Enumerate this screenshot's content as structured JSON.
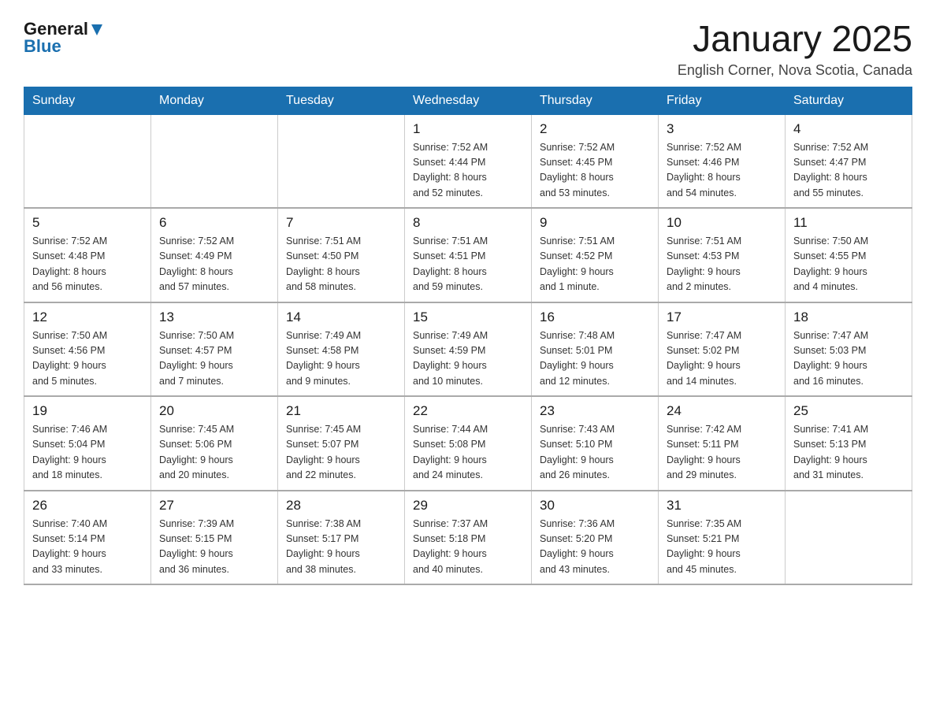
{
  "header": {
    "logo_general": "General",
    "logo_blue": "Blue",
    "title": "January 2025",
    "subtitle": "English Corner, Nova Scotia, Canada"
  },
  "days_of_week": [
    "Sunday",
    "Monday",
    "Tuesday",
    "Wednesday",
    "Thursday",
    "Friday",
    "Saturday"
  ],
  "weeks": [
    [
      {
        "day": "",
        "info": ""
      },
      {
        "day": "",
        "info": ""
      },
      {
        "day": "",
        "info": ""
      },
      {
        "day": "1",
        "info": "Sunrise: 7:52 AM\nSunset: 4:44 PM\nDaylight: 8 hours\nand 52 minutes."
      },
      {
        "day": "2",
        "info": "Sunrise: 7:52 AM\nSunset: 4:45 PM\nDaylight: 8 hours\nand 53 minutes."
      },
      {
        "day": "3",
        "info": "Sunrise: 7:52 AM\nSunset: 4:46 PM\nDaylight: 8 hours\nand 54 minutes."
      },
      {
        "day": "4",
        "info": "Sunrise: 7:52 AM\nSunset: 4:47 PM\nDaylight: 8 hours\nand 55 minutes."
      }
    ],
    [
      {
        "day": "5",
        "info": "Sunrise: 7:52 AM\nSunset: 4:48 PM\nDaylight: 8 hours\nand 56 minutes."
      },
      {
        "day": "6",
        "info": "Sunrise: 7:52 AM\nSunset: 4:49 PM\nDaylight: 8 hours\nand 57 minutes."
      },
      {
        "day": "7",
        "info": "Sunrise: 7:51 AM\nSunset: 4:50 PM\nDaylight: 8 hours\nand 58 minutes."
      },
      {
        "day": "8",
        "info": "Sunrise: 7:51 AM\nSunset: 4:51 PM\nDaylight: 8 hours\nand 59 minutes."
      },
      {
        "day": "9",
        "info": "Sunrise: 7:51 AM\nSunset: 4:52 PM\nDaylight: 9 hours\nand 1 minute."
      },
      {
        "day": "10",
        "info": "Sunrise: 7:51 AM\nSunset: 4:53 PM\nDaylight: 9 hours\nand 2 minutes."
      },
      {
        "day": "11",
        "info": "Sunrise: 7:50 AM\nSunset: 4:55 PM\nDaylight: 9 hours\nand 4 minutes."
      }
    ],
    [
      {
        "day": "12",
        "info": "Sunrise: 7:50 AM\nSunset: 4:56 PM\nDaylight: 9 hours\nand 5 minutes."
      },
      {
        "day": "13",
        "info": "Sunrise: 7:50 AM\nSunset: 4:57 PM\nDaylight: 9 hours\nand 7 minutes."
      },
      {
        "day": "14",
        "info": "Sunrise: 7:49 AM\nSunset: 4:58 PM\nDaylight: 9 hours\nand 9 minutes."
      },
      {
        "day": "15",
        "info": "Sunrise: 7:49 AM\nSunset: 4:59 PM\nDaylight: 9 hours\nand 10 minutes."
      },
      {
        "day": "16",
        "info": "Sunrise: 7:48 AM\nSunset: 5:01 PM\nDaylight: 9 hours\nand 12 minutes."
      },
      {
        "day": "17",
        "info": "Sunrise: 7:47 AM\nSunset: 5:02 PM\nDaylight: 9 hours\nand 14 minutes."
      },
      {
        "day": "18",
        "info": "Sunrise: 7:47 AM\nSunset: 5:03 PM\nDaylight: 9 hours\nand 16 minutes."
      }
    ],
    [
      {
        "day": "19",
        "info": "Sunrise: 7:46 AM\nSunset: 5:04 PM\nDaylight: 9 hours\nand 18 minutes."
      },
      {
        "day": "20",
        "info": "Sunrise: 7:45 AM\nSunset: 5:06 PM\nDaylight: 9 hours\nand 20 minutes."
      },
      {
        "day": "21",
        "info": "Sunrise: 7:45 AM\nSunset: 5:07 PM\nDaylight: 9 hours\nand 22 minutes."
      },
      {
        "day": "22",
        "info": "Sunrise: 7:44 AM\nSunset: 5:08 PM\nDaylight: 9 hours\nand 24 minutes."
      },
      {
        "day": "23",
        "info": "Sunrise: 7:43 AM\nSunset: 5:10 PM\nDaylight: 9 hours\nand 26 minutes."
      },
      {
        "day": "24",
        "info": "Sunrise: 7:42 AM\nSunset: 5:11 PM\nDaylight: 9 hours\nand 29 minutes."
      },
      {
        "day": "25",
        "info": "Sunrise: 7:41 AM\nSunset: 5:13 PM\nDaylight: 9 hours\nand 31 minutes."
      }
    ],
    [
      {
        "day": "26",
        "info": "Sunrise: 7:40 AM\nSunset: 5:14 PM\nDaylight: 9 hours\nand 33 minutes."
      },
      {
        "day": "27",
        "info": "Sunrise: 7:39 AM\nSunset: 5:15 PM\nDaylight: 9 hours\nand 36 minutes."
      },
      {
        "day": "28",
        "info": "Sunrise: 7:38 AM\nSunset: 5:17 PM\nDaylight: 9 hours\nand 38 minutes."
      },
      {
        "day": "29",
        "info": "Sunrise: 7:37 AM\nSunset: 5:18 PM\nDaylight: 9 hours\nand 40 minutes."
      },
      {
        "day": "30",
        "info": "Sunrise: 7:36 AM\nSunset: 5:20 PM\nDaylight: 9 hours\nand 43 minutes."
      },
      {
        "day": "31",
        "info": "Sunrise: 7:35 AM\nSunset: 5:21 PM\nDaylight: 9 hours\nand 45 minutes."
      },
      {
        "day": "",
        "info": ""
      }
    ]
  ]
}
